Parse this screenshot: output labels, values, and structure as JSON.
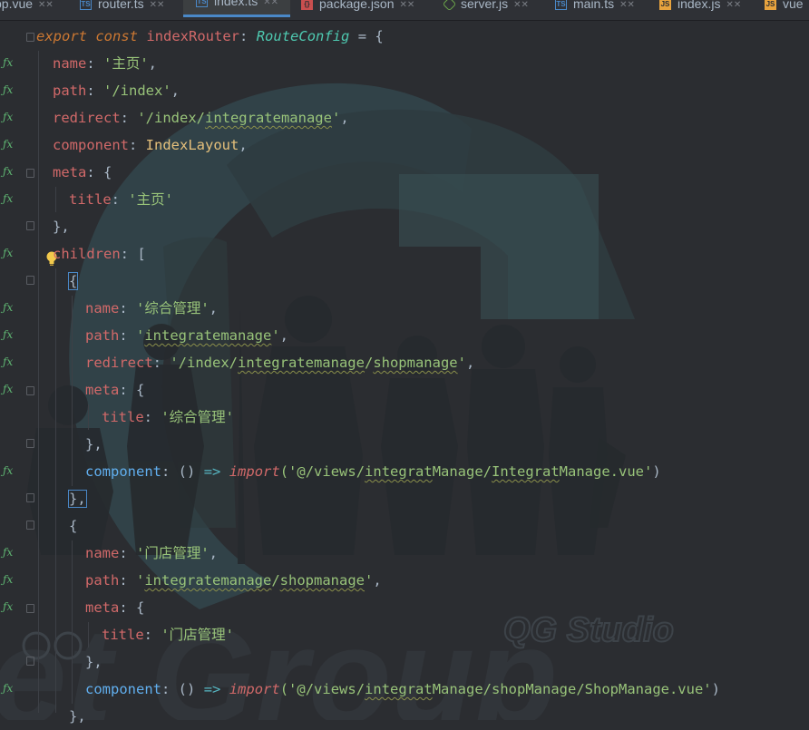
{
  "tabs": [
    {
      "label": "pp.vue",
      "icon": "vue-file-icon",
      "kind": "vue"
    },
    {
      "label": "router.ts",
      "icon": "ts-file-icon",
      "kind": "ts"
    },
    {
      "label": "index.ts",
      "icon": "ts-file-icon",
      "kind": "ts",
      "active": true
    },
    {
      "label": "package.json",
      "icon": "json-file-icon",
      "kind": "json"
    },
    {
      "label": "server.js",
      "icon": "node-file-icon",
      "kind": "node"
    },
    {
      "label": "main.ts",
      "icon": "ts-file-icon",
      "kind": "ts"
    },
    {
      "label": "index.js",
      "icon": "js-file-icon",
      "kind": "js"
    },
    {
      "label": "vue",
      "icon": "js-file-icon",
      "kind": "js"
    }
  ],
  "code": {
    "l1": {
      "kw1": "export",
      "kw2": "const",
      "name": "indexRouter",
      "colon": ":",
      "type": "RouteConfig",
      "eq": " = {"
    },
    "l2": {
      "key": "name",
      "val": "'主页'"
    },
    "l3": {
      "key": "path",
      "val": "'/index'"
    },
    "l4": {
      "key": "redirect",
      "val_a": "'/index/",
      "val_b": "integratemanage",
      "val_c": "'"
    },
    "l5": {
      "key": "component",
      "val": "IndexLayout"
    },
    "l6": {
      "key": "meta",
      "open": "{"
    },
    "l7": {
      "key": "title",
      "val": "'主页'"
    },
    "l8": {
      "close": "},"
    },
    "l9": {
      "key": "children",
      "open": "["
    },
    "l10": {
      "open": "{"
    },
    "l11": {
      "key": "name",
      "val": "'综合管理'"
    },
    "l12": {
      "key": "path",
      "val_a": "'",
      "val_b": "integratemanage",
      "val_c": "'"
    },
    "l13": {
      "key": "redirect",
      "val_a": "'/index/",
      "val_b": "integratemanage",
      "val_c": "/",
      "val_d": "shopmanage",
      "val_e": "'"
    },
    "l14": {
      "key": "meta",
      "open": "{"
    },
    "l15": {
      "key": "title",
      "val": "'综合管理'"
    },
    "l16": {
      "close": "},"
    },
    "l17": {
      "key": "component",
      "parens": "()",
      "arrow": "=>",
      "fn": "import",
      "p1": "('@/views/",
      "p2": "integrat",
      "p3": "Manage/",
      "p4": "Integrat",
      "p5": "Manage.vue'",
      "p6": ")"
    },
    "l18": {
      "close": "},"
    },
    "l19": {
      "open": "{"
    },
    "l20": {
      "key": "name",
      "val": "'门店管理'"
    },
    "l21": {
      "key": "path",
      "val_a": "'",
      "val_b": "integratemanage",
      "val_c": "/",
      "val_d": "shopmanage",
      "val_e": "'"
    },
    "l22": {
      "key": "meta",
      "open": "{"
    },
    "l23": {
      "key": "title",
      "val": "'门店管理'"
    },
    "l24": {
      "close": "},"
    },
    "l25": {
      "key": "component",
      "parens": "()",
      "arrow": "=>",
      "fn": "import",
      "p1": "('@/views/",
      "p2": "integrat",
      "p3": "Manage/shopManage/ShopManage.vue'",
      "p4": ")"
    },
    "l26": {
      "close": "},"
    }
  },
  "watermark": {
    "studio": "QG Studio",
    "big": "et Group"
  },
  "colors": {
    "accent": "#4a88c7",
    "background": "#2b2d31",
    "string": "#98c379",
    "property": "#d16969",
    "keyword": "#cc7832"
  }
}
